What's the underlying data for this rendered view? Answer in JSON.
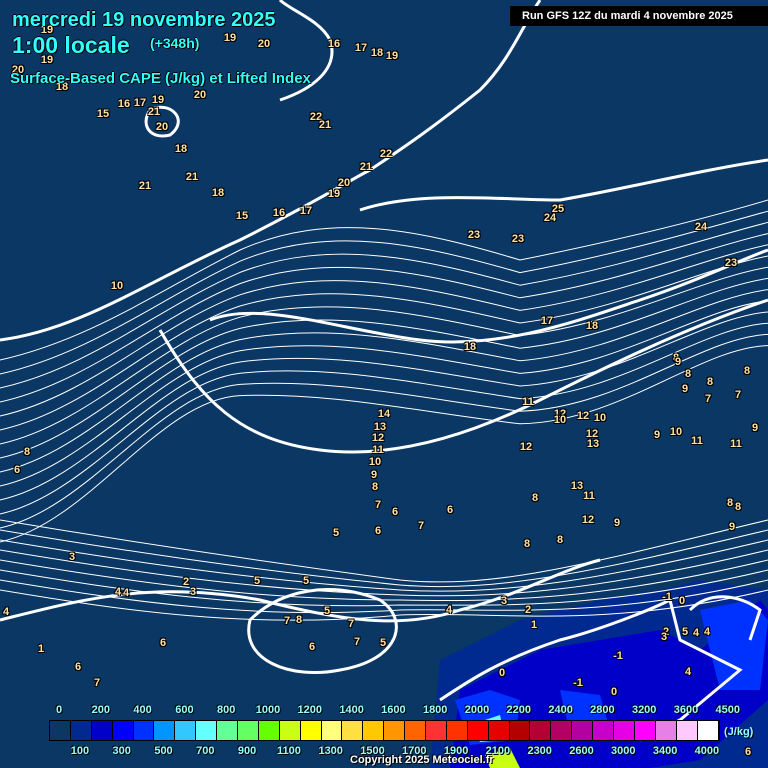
{
  "header": {
    "date": "mercredi 19 novembre 2025",
    "time": "1:00 locale",
    "lead": "(+348h)",
    "product": "Surface-Based CAPE (J/kg) et Lifted Index",
    "run": "Run GFS 12Z du mardi 4 novembre 2025"
  },
  "legend": {
    "top_ticks": [
      "0",
      "200",
      "400",
      "600",
      "800",
      "1000",
      "1200",
      "1400",
      "1600",
      "1800",
      "2000",
      "2200",
      "2400",
      "2800",
      "3200",
      "3600",
      "4500"
    ],
    "bottom_ticks": [
      "100",
      "300",
      "500",
      "700",
      "900",
      "1100",
      "1300",
      "1500",
      "1700",
      "1900",
      "2100",
      "2300",
      "2600",
      "3000",
      "3400",
      "4000"
    ],
    "unit": "(J/kg)",
    "colors": [
      "#0a1540",
      "#0a3764",
      "#002a90",
      "#0000c8",
      "#0000ff",
      "#0032ff",
      "#0096ff",
      "#32c8ff",
      "#64ffff",
      "#64ff96",
      "#64ff64",
      "#64ff00",
      "#c8ff14",
      "#ffff00",
      "#ffff80",
      "#ffe040",
      "#ffc800",
      "#ff9600",
      "#ff6400",
      "#ff3232",
      "#ff3200",
      "#ff0000",
      "#e60000",
      "#b40000",
      "#b40032",
      "#b40064",
      "#b400a0",
      "#c800c8",
      "#e600e6",
      "#ff00ff",
      "#e680e6",
      "#ffc8ff",
      "#ffffff"
    ]
  },
  "lifted_index_labels": [
    "19",
    "19",
    "18",
    "20",
    "20",
    "19",
    "20",
    "16",
    "17",
    "18",
    "19",
    "15",
    "16",
    "17",
    "19",
    "21",
    "20",
    "22",
    "21",
    "18",
    "21",
    "22",
    "21",
    "20",
    "18",
    "21",
    "19",
    "15",
    "16",
    "17",
    "10",
    "25",
    "24",
    "23",
    "23",
    "24",
    "23",
    "17",
    "18",
    "18",
    "14",
    "13",
    "12",
    "11",
    "10",
    "9",
    "8",
    "11",
    "12",
    "10",
    "12",
    "10",
    "12",
    "13",
    "10",
    "11",
    "9",
    "12",
    "11",
    "8",
    "9",
    "8",
    "7",
    "9",
    "8",
    "7",
    "9",
    "8",
    "6",
    "8",
    "7",
    "6",
    "6",
    "5",
    "6",
    "7",
    "8",
    "8",
    "8",
    "13",
    "11",
    "12",
    "9",
    "8",
    "8",
    "9",
    "3",
    "2",
    "3",
    "4",
    "4",
    "5",
    "5",
    "7",
    "8",
    "5",
    "7",
    "5",
    "6",
    "7",
    "4",
    "3",
    "2",
    "1",
    "0",
    "-1",
    "-1",
    "0",
    "-1",
    "0",
    "2",
    "3",
    "5",
    "4",
    "4",
    "4",
    "1",
    "6",
    "7",
    "6",
    "4",
    "7",
    "6",
    "5",
    "3",
    "6"
  ],
  "copyright": "Copyright 2025 Meteociel.fr"
}
